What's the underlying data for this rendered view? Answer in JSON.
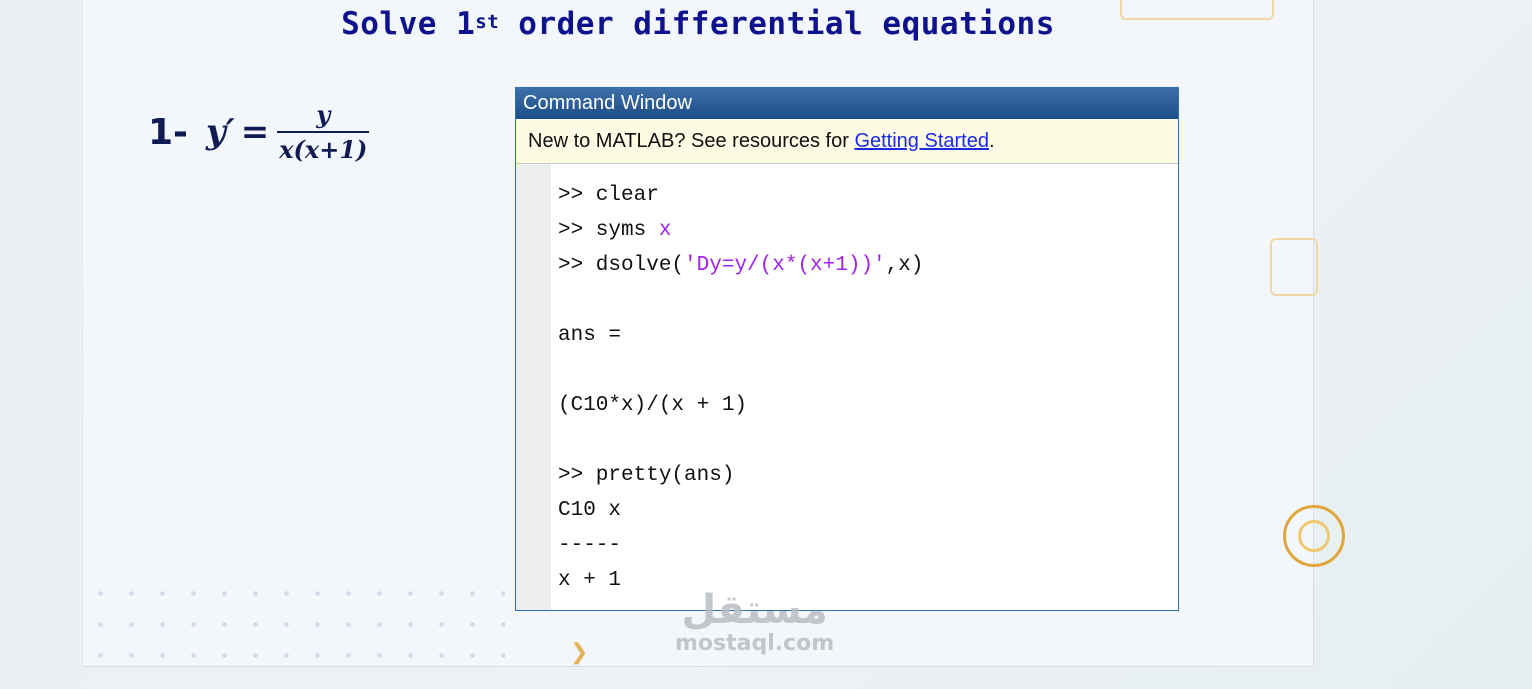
{
  "slide": {
    "title": "Solve 1",
    "title_sup": "st",
    "title_rest": " order differential equations",
    "equation": {
      "number": "1-",
      "lhs": "y′",
      "equals": "=",
      "numerator": "y",
      "denominator": "x(x+1)"
    }
  },
  "command_window": {
    "title": "Command Window",
    "banner_text": "New to MATLAB? See resources for ",
    "banner_link": "Getting Started",
    "banner_end": ".",
    "lines": [
      {
        "prefix": ">> clear",
        "highlight": "",
        "suffix": ""
      },
      {
        "prefix": ">> syms ",
        "highlight": "x",
        "suffix": ""
      },
      {
        "prefix": ">> dsolve(",
        "highlight": "'Dy=y/(x*(x+1))'",
        "suffix": ",x)"
      },
      {
        "prefix": "",
        "highlight": "",
        "suffix": ""
      },
      {
        "prefix": "ans =",
        "highlight": "",
        "suffix": ""
      },
      {
        "prefix": "",
        "highlight": "",
        "suffix": ""
      },
      {
        "prefix": "(C10*x)/(x + 1)",
        "highlight": "",
        "suffix": ""
      },
      {
        "prefix": "",
        "highlight": "",
        "suffix": ""
      },
      {
        "prefix": ">> pretty(ans)",
        "highlight": "",
        "suffix": ""
      },
      {
        "prefix": "C10 x",
        "highlight": "",
        "suffix": ""
      },
      {
        "prefix": "-----",
        "highlight": "",
        "suffix": ""
      },
      {
        "prefix": "x + 1",
        "highlight": "",
        "suffix": ""
      }
    ]
  },
  "watermark": {
    "arabic": "مستقل",
    "latin": "mostaql.com"
  },
  "colors": {
    "title": "#0e128c",
    "keyword": "#a020f0",
    "link": "#1a2be8",
    "accent": "#e0a63c"
  }
}
